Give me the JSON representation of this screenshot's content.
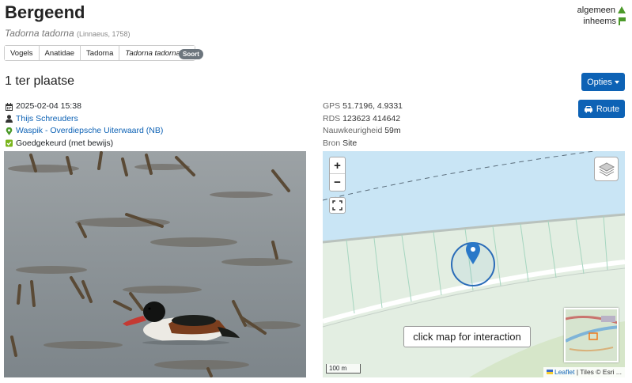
{
  "species": {
    "common_name": "Bergeend",
    "scientific_name": "Tadorna tadorna",
    "author": "(Linnaeus, 1758)"
  },
  "status": {
    "abundance": "algemeen",
    "origin": "inheems",
    "colors": {
      "indicator": "#4c9a2a"
    }
  },
  "taxonomy": {
    "crumbs": [
      "Vogels",
      "Anatidae",
      "Tadorna",
      "Tadorna tadorna"
    ],
    "rank_badge": "Soort"
  },
  "observation": {
    "count_label": "1 ter plaatse",
    "datetime": "2025-02-04 15:38",
    "observer": "Thijs Schreuders",
    "location": "Waspik - Overdiepsche Uiterwaard (NB)",
    "validation": "Goedgekeurd (met bewijs)"
  },
  "actions": {
    "options_label": "Opties",
    "route_label": "Route"
  },
  "location_info": {
    "gps_label": "GPS",
    "gps_value": "51.7196, 4.9331",
    "rds_label": "RDS",
    "rds_value": "123623 414642",
    "accuracy_label": "Nauwkeurigheid",
    "accuracy_value": "59m",
    "source_label": "Bron",
    "source_value": "Site"
  },
  "map": {
    "zoom_in": "+",
    "zoom_out": "−",
    "tooltip": "click map for interaction",
    "scale_label": "100 m",
    "attribution_link": "Leaflet",
    "attribution_text": "| Tiles © Esri ..."
  },
  "colors": {
    "primary": "#0d62b5",
    "badge": "#6c757d"
  }
}
